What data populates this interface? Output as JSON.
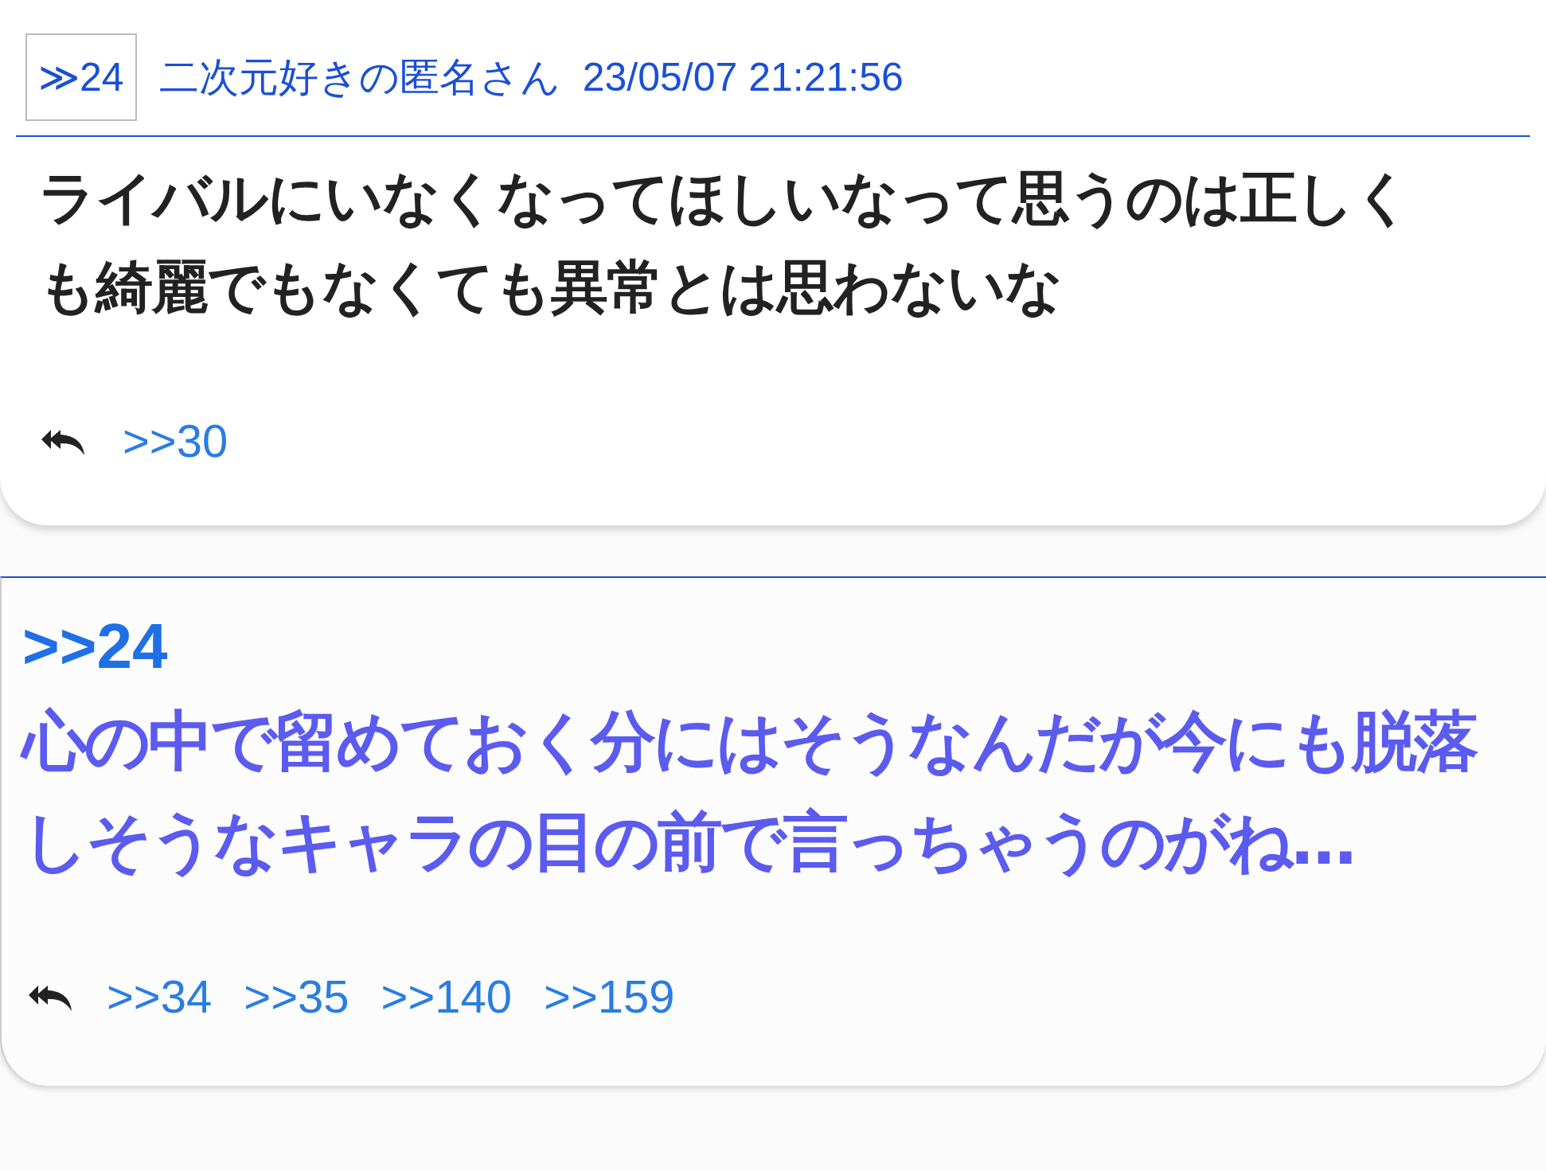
{
  "popup": {
    "number": "≫24",
    "name": "二次元好きの匿名さん",
    "datetime": "23/05/07  21:21:56",
    "body": "ライバルにいなくなってほしいなって思うのは正しくも綺麗でもなくても異常とは思わないな",
    "replies": [
      ">>30"
    ]
  },
  "post": {
    "anchor": ">>24",
    "body": "心の中で留めておく分にはそうなんだが今にも脱落しそうなキャラの目の前で言っちゃうのがね…",
    "replies": [
      ">>34",
      ">>35",
      ">>140",
      ">>159"
    ]
  }
}
